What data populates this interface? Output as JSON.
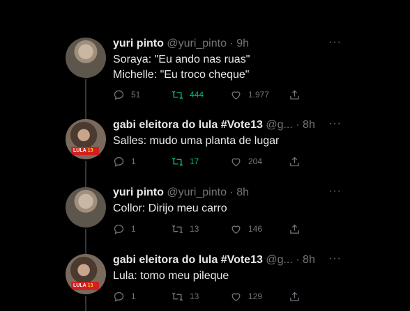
{
  "tweets": [
    {
      "name": "yuri pinto",
      "handle": "@yuri_pinto",
      "time": "· 9h",
      "more": "···",
      "lines": [
        "Soraya: \"Eu ando nas ruas\"",
        "Michelle: \"Eu troco cheque\""
      ],
      "replies": "51",
      "retweets": "444",
      "likes": "1.977",
      "retweeted": true,
      "avatar": "yuri-avatar"
    },
    {
      "name": "gabi eleitora do lula #Vote13",
      "handle": "@g...",
      "time": "· 8h",
      "more": "···",
      "lines": [
        "Salles: mudo uma planta de lugar"
      ],
      "replies": "1",
      "retweets": "17",
      "likes": "204",
      "retweeted": true,
      "avatar": "gabi-avatar",
      "badge": "LULA",
      "badge_num": "13"
    },
    {
      "name": "yuri pinto",
      "handle": "@yuri_pinto",
      "time": "· 8h",
      "more": "···",
      "lines": [
        "Collor: Dirijo meu carro"
      ],
      "replies": "1",
      "retweets": "13",
      "likes": "146",
      "retweeted": false,
      "avatar": "yuri-avatar"
    },
    {
      "name": "gabi eleitora do lula #Vote13",
      "handle": "@g...",
      "time": "· 8h",
      "more": "···",
      "lines": [
        "Lula: tomo meu pileque"
      ],
      "replies": "1",
      "retweets": "13",
      "likes": "129",
      "retweeted": false,
      "avatar": "gabi-avatar",
      "badge": "LULA",
      "badge_num": "13"
    }
  ],
  "colors": {
    "background": "#000000",
    "text": "#e7e9ea",
    "muted": "#71767b",
    "retweet": "#00ba7c",
    "thread": "#333639"
  }
}
